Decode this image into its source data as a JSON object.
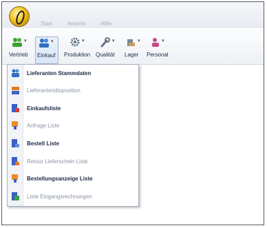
{
  "menu": {
    "tabs": [
      {
        "label": "Start"
      },
      {
        "label": "Ansicht"
      },
      {
        "label": "Hilfe"
      }
    ]
  },
  "ribbon": {
    "buttons": [
      {
        "label": "Vertrieb",
        "icon": "group-people-icon",
        "color": "#3f9e2e"
      },
      {
        "label": "Einkauf",
        "icon": "group-people-icon",
        "color": "#2f6fbf"
      },
      {
        "label": "Produktion",
        "icon": "gear-icon",
        "color": "#5d6f86"
      },
      {
        "label": "Qualität",
        "icon": "wrench-icon",
        "color": "#6a7688"
      },
      {
        "label": "Lager",
        "icon": "warehouse-icon",
        "color": "#7d8795"
      },
      {
        "label": "Personal",
        "icon": "people-icon",
        "color": "#c44a8a"
      }
    ]
  },
  "dropdown": {
    "items": [
      {
        "label": "Lieferanten Stammdaten",
        "icon": "suppliers-icon",
        "color": "#2f6fbf"
      },
      {
        "label": "Lieferantendisposition",
        "icon": "disposition-icon",
        "color": "#e07b20"
      },
      {
        "label": "Einkaufsliste",
        "icon": "list-icon",
        "color": "#3a5fc8"
      },
      {
        "label": "Anfrage Liste",
        "icon": "request-list-icon",
        "color": "#f08a24"
      },
      {
        "label": "Bestell Liste",
        "icon": "order-list-icon",
        "color": "#3a5fc8"
      },
      {
        "label": "Retour Lieferschein Liste",
        "icon": "return-list-icon",
        "color": "#3a5fc8"
      },
      {
        "label": "Bestellungsanzeige Liste",
        "icon": "order-display-icon",
        "color": "#f08a24"
      },
      {
        "label": "Liste Eingangsrechnungen",
        "icon": "invoice-list-icon",
        "color": "#3ba04a"
      }
    ]
  }
}
